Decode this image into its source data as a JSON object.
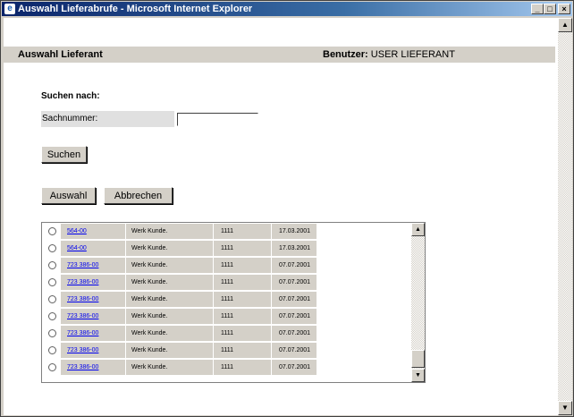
{
  "window": {
    "title": "Auswahl Lieferabrufe - Microsoft Internet Explorer",
    "controls": {
      "minimize": "_",
      "maximize": "□",
      "close": "×"
    }
  },
  "header": {
    "title": "Auswahl Lieferant",
    "user_label": "Benutzer:",
    "user_value": "USER LIEFERANT"
  },
  "search": {
    "heading": "Suchen nach:",
    "field_label": "Sachnummer:",
    "field_value": "",
    "submit_label": "Suchen"
  },
  "actions": {
    "select_label": "Auswahl",
    "cancel_label": "Abbrechen"
  },
  "results": [
    {
      "part": "564-00",
      "werk": "Werk Kunde.",
      "number": "1111",
      "date": "17.03.2001"
    },
    {
      "part": "564-00",
      "werk": "Werk Kunde.",
      "number": "1111",
      "date": "17.03.2001"
    },
    {
      "part": "723 386-00",
      "werk": "Werk Kunde.",
      "number": "1111",
      "date": "07.07.2001"
    },
    {
      "part": "723 386-00",
      "werk": "Werk Kunde.",
      "number": "1111",
      "date": "07.07.2001"
    },
    {
      "part": "723 386-00",
      "werk": "Werk Kunde.",
      "number": "1111",
      "date": "07.07.2001"
    },
    {
      "part": "723 386-00",
      "werk": "Werk Kunde.",
      "number": "1111",
      "date": "07.07.2001"
    },
    {
      "part": "723 386-00",
      "werk": "Werk Kunde.",
      "number": "1111",
      "date": "07.07.2001"
    },
    {
      "part": "723 386-00",
      "werk": "Werk Kunde.",
      "number": "1111",
      "date": "07.07.2001"
    },
    {
      "part": "723 386-00",
      "werk": "Werk Kunde.",
      "number": "1111",
      "date": "07.07.2001"
    }
  ],
  "colors": {
    "titlebar": "#0a246a",
    "link": "#0000ee",
    "panel": "#d4d0c8"
  }
}
